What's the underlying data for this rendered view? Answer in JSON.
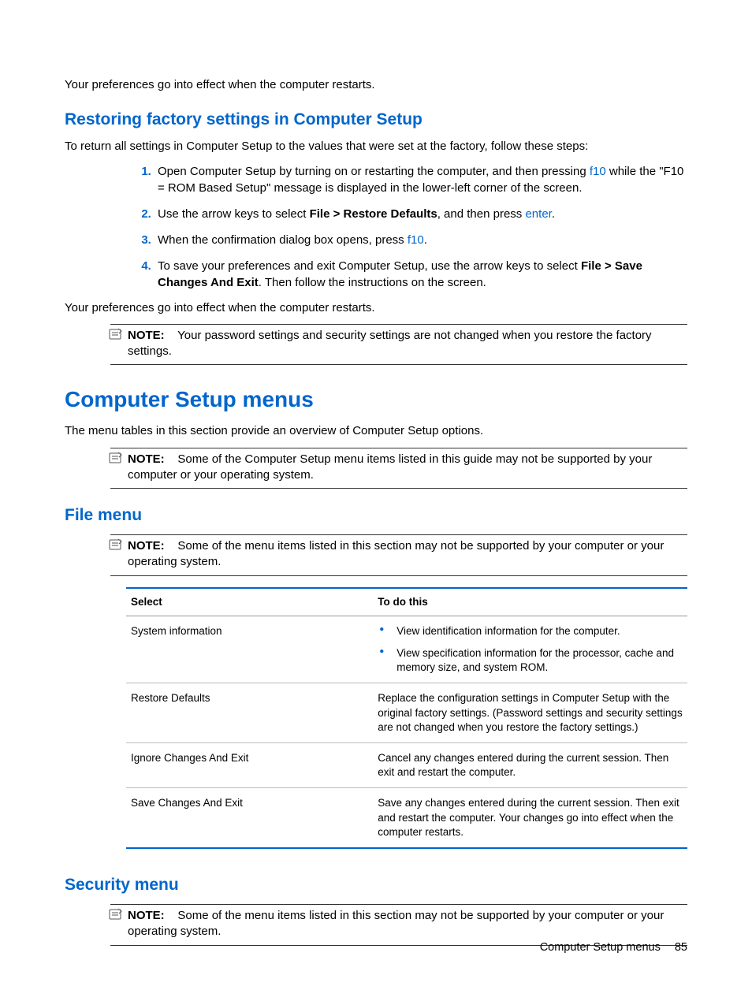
{
  "intro_prefs_text": "Your preferences go into effect when the computer restarts.",
  "restoring": {
    "heading": "Restoring factory settings in Computer Setup",
    "intro": "To return all settings in Computer Setup to the values that were set at the factory, follow these steps:",
    "steps": {
      "s1a": "Open Computer Setup by turning on or restarting the computer, and then pressing ",
      "s1_key": "f10",
      "s1b": " while the \"F10 = ROM Based Setup\" message is displayed in the lower-left corner of the screen.",
      "s2a": "Use the arrow keys to select ",
      "s2_bold": "File > Restore Defaults",
      "s2b": ", and then press ",
      "s2_key": "enter",
      "s2c": ".",
      "s3a": "When the confirmation dialog box opens, press ",
      "s3_key": "f10",
      "s3b": ".",
      "s4a": "To save your preferences and exit Computer Setup, use the arrow keys to select ",
      "s4_bold": "File > Save Changes And Exit",
      "s4b": ". Then follow the instructions on the screen."
    },
    "after": "Your preferences go into effect when the computer restarts.",
    "note_label": "NOTE:",
    "note_text": "Your password settings and security settings are not changed when you restore the factory settings."
  },
  "menus": {
    "heading": "Computer Setup menus",
    "intro": "The menu tables in this section provide an overview of Computer Setup options.",
    "note_label": "NOTE:",
    "note_text": "Some of the Computer Setup menu items listed in this guide may not be supported by your computer or your operating system."
  },
  "file_menu": {
    "heading": "File menu",
    "note_label": "NOTE:",
    "note_text": "Some of the menu items listed in this section may not be supported by your computer or your operating system.",
    "th_select": "Select",
    "th_todo": "To do this",
    "rows": {
      "r0_select": "System information",
      "r0_b1": "View identification information for the computer.",
      "r0_b2": "View specification information for the processor, cache and memory size, and system ROM.",
      "r1_select": "Restore Defaults",
      "r1_todo": "Replace the configuration settings in Computer Setup with the original factory settings. (Password settings and security settings are not changed when you restore the factory settings.)",
      "r2_select": "Ignore Changes And Exit",
      "r2_todo": "Cancel any changes entered during the current session. Then exit and restart the computer.",
      "r3_select": "Save Changes And Exit",
      "r3_todo": "Save any changes entered during the current session. Then exit and restart the computer. Your changes go into effect when the computer restarts."
    }
  },
  "security_menu": {
    "heading": "Security menu",
    "note_label": "NOTE:",
    "note_text": "Some of the menu items listed in this section may not be supported by your computer or your operating system."
  },
  "footer": {
    "text": "Computer Setup menus",
    "page": "85"
  },
  "chart_data": {
    "type": "table",
    "title": "File menu",
    "columns": [
      "Select",
      "To do this"
    ],
    "rows": [
      [
        "System information",
        [
          "View identification information for the computer.",
          "View specification information for the processor, cache and memory size, and system ROM."
        ]
      ],
      [
        "Restore Defaults",
        "Replace the configuration settings in Computer Setup with the original factory settings. (Password settings and security settings are not changed when you restore the factory settings.)"
      ],
      [
        "Ignore Changes And Exit",
        "Cancel any changes entered during the current session. Then exit and restart the computer."
      ],
      [
        "Save Changes And Exit",
        "Save any changes entered during the current session. Then exit and restart the computer. Your changes go into effect when the computer restarts."
      ]
    ]
  }
}
